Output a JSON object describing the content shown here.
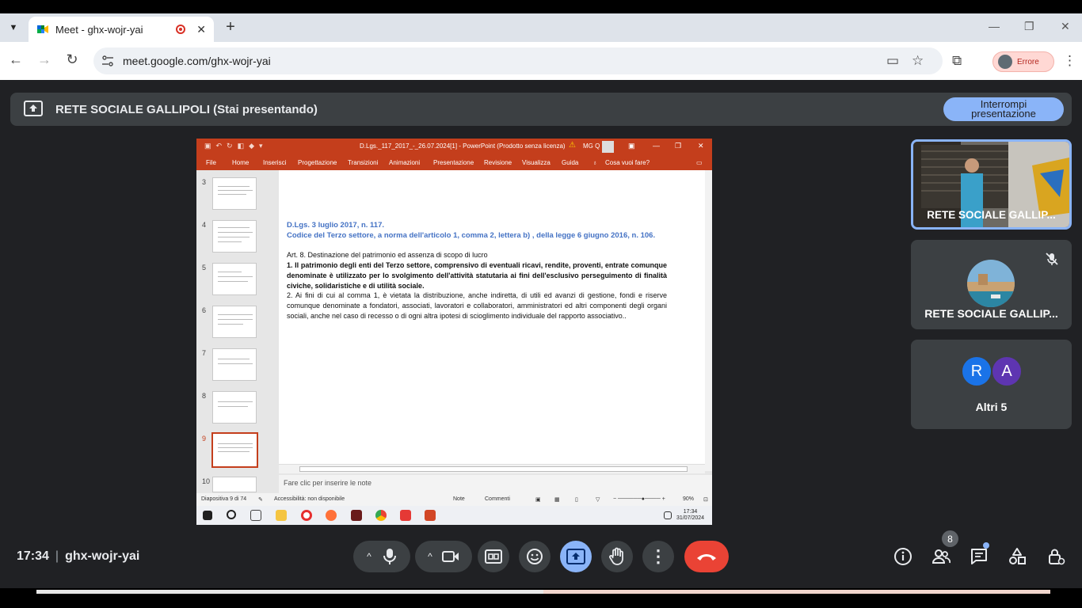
{
  "browser": {
    "tab_title": "Meet - ghx-wojr-yai",
    "new_tab_symbol": "+",
    "close_symbol": "✕",
    "url": "meet.google.com/ghx-wojr-yai",
    "profile_label": "Errore"
  },
  "meet": {
    "banner_title": "RETE SOCIALE GALLIPOLI (Stai presentando)",
    "stop_presenting_label": "Interrompi presentazione",
    "clock": "17:34",
    "meeting_code": "ghx-wojr-yai",
    "participants_count": "8",
    "accent_color": "#8ab4f8",
    "end_call_color": "#ea4335"
  },
  "tiles": [
    {
      "name": "RETE SOCIALE GALLIP..."
    },
    {
      "name": "RETE SOCIALE GALLIP..."
    },
    {
      "name": "Altri 5",
      "avatars": [
        "R",
        "A"
      ]
    }
  ],
  "ppt": {
    "window_title": "D.Lgs._117_2017_-_26.07.2024[1] - PowerPoint (Prodotto senza licenza)",
    "user_initials": "MG Q",
    "ribbon_tabs": [
      "File",
      "Home",
      "Inserisci",
      "Progettazione",
      "Transizioni",
      "Animazioni",
      "Presentazione",
      "Revisione",
      "Visualizza",
      "Guida",
      "Cosa vuoi fare?"
    ],
    "thumb_numbers": [
      "3",
      "4",
      "5",
      "6",
      "7",
      "8",
      "9",
      "10"
    ],
    "slide": {
      "heading1": "D.Lgs. 3 luglio 2017, n. 117.",
      "heading2": "Codice del Terzo settore, a norma dell'articolo 1, comma 2, lettera b) , della legge 6 giugno 2016, n. 106.",
      "article_title": "Art. 8. Destinazione del patrimonio ed assenza di scopo di lucro",
      "paragraph1": "1. Il patrimonio degli enti del Terzo settore, comprensivo di eventuali ricavi, rendite, proventi, entrate comunque denominate è utilizzato per lo svolgimento dell'attività statutaria ai fini dell'esclusivo perseguimento di finalità civiche, solidaristiche e di utilità sociale.",
      "paragraph2": "2. Ai fini di cui al comma 1, è vietata la distribuzione, anche indiretta, di utili ed avanzi di gestione, fondi e riserve comunque denominate a fondatori, associati, lavoratori e collaboratori, amministratori ed altri componenti degli organi sociali, anche nel caso di recesso o di ogni altra ipotesi di scioglimento individuale del rapporto associativo.."
    },
    "notes_placeholder": "Fare clic per inserire le note",
    "status": {
      "slide_counter": "Diapositiva 9 di 74",
      "accessibility": "Accessibilità: non disponibile",
      "notes": "Note",
      "comments": "Commenti",
      "zoom": "90%"
    },
    "taskbar_time": "17:34",
    "taskbar_date": "31/07/2024"
  }
}
